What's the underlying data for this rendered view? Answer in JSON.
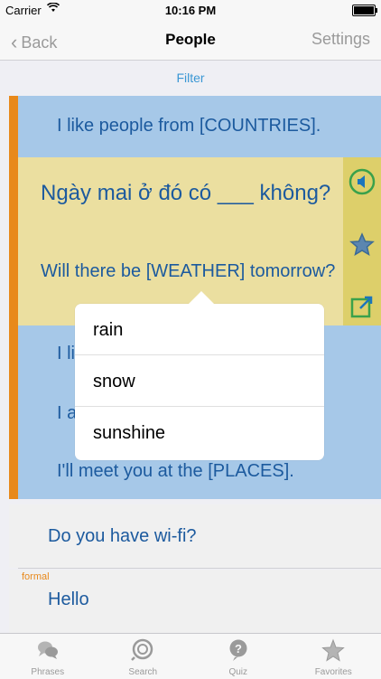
{
  "status": {
    "carrier": "Carrier",
    "time": "10:16 PM"
  },
  "nav": {
    "back": "Back",
    "title": "People",
    "settings": "Settings"
  },
  "filter": "Filter",
  "rows": [
    {
      "text": "I like people from [COUNTRIES]."
    },
    {
      "vietnamese": "Ngày mai ở đó có ___ không?",
      "english": "Will there be [WEATHER] tomorrow?"
    },
    {
      "text": "I lik"
    },
    {
      "text": "I ar"
    },
    {
      "text": "I'll meet you at the [PLACES]."
    },
    {
      "text": "Do you have wi-fi?"
    },
    {
      "tag": "formal",
      "text": "Hello"
    }
  ],
  "popover": {
    "options": [
      "rain",
      "snow",
      "sunshine"
    ]
  },
  "tabs": [
    {
      "label": "Phrases",
      "icon": "phrases-icon"
    },
    {
      "label": "Search",
      "icon": "search-icon"
    },
    {
      "label": "Quiz",
      "icon": "quiz-icon"
    },
    {
      "label": "Favorites",
      "icon": "favorites-icon"
    }
  ],
  "colors": {
    "accent": "#e8891b",
    "link": "#3a97d4",
    "rowBlue": "#a6c8e8",
    "rowYellow": "#ebdfa0",
    "speaker": "#3aa14b"
  }
}
